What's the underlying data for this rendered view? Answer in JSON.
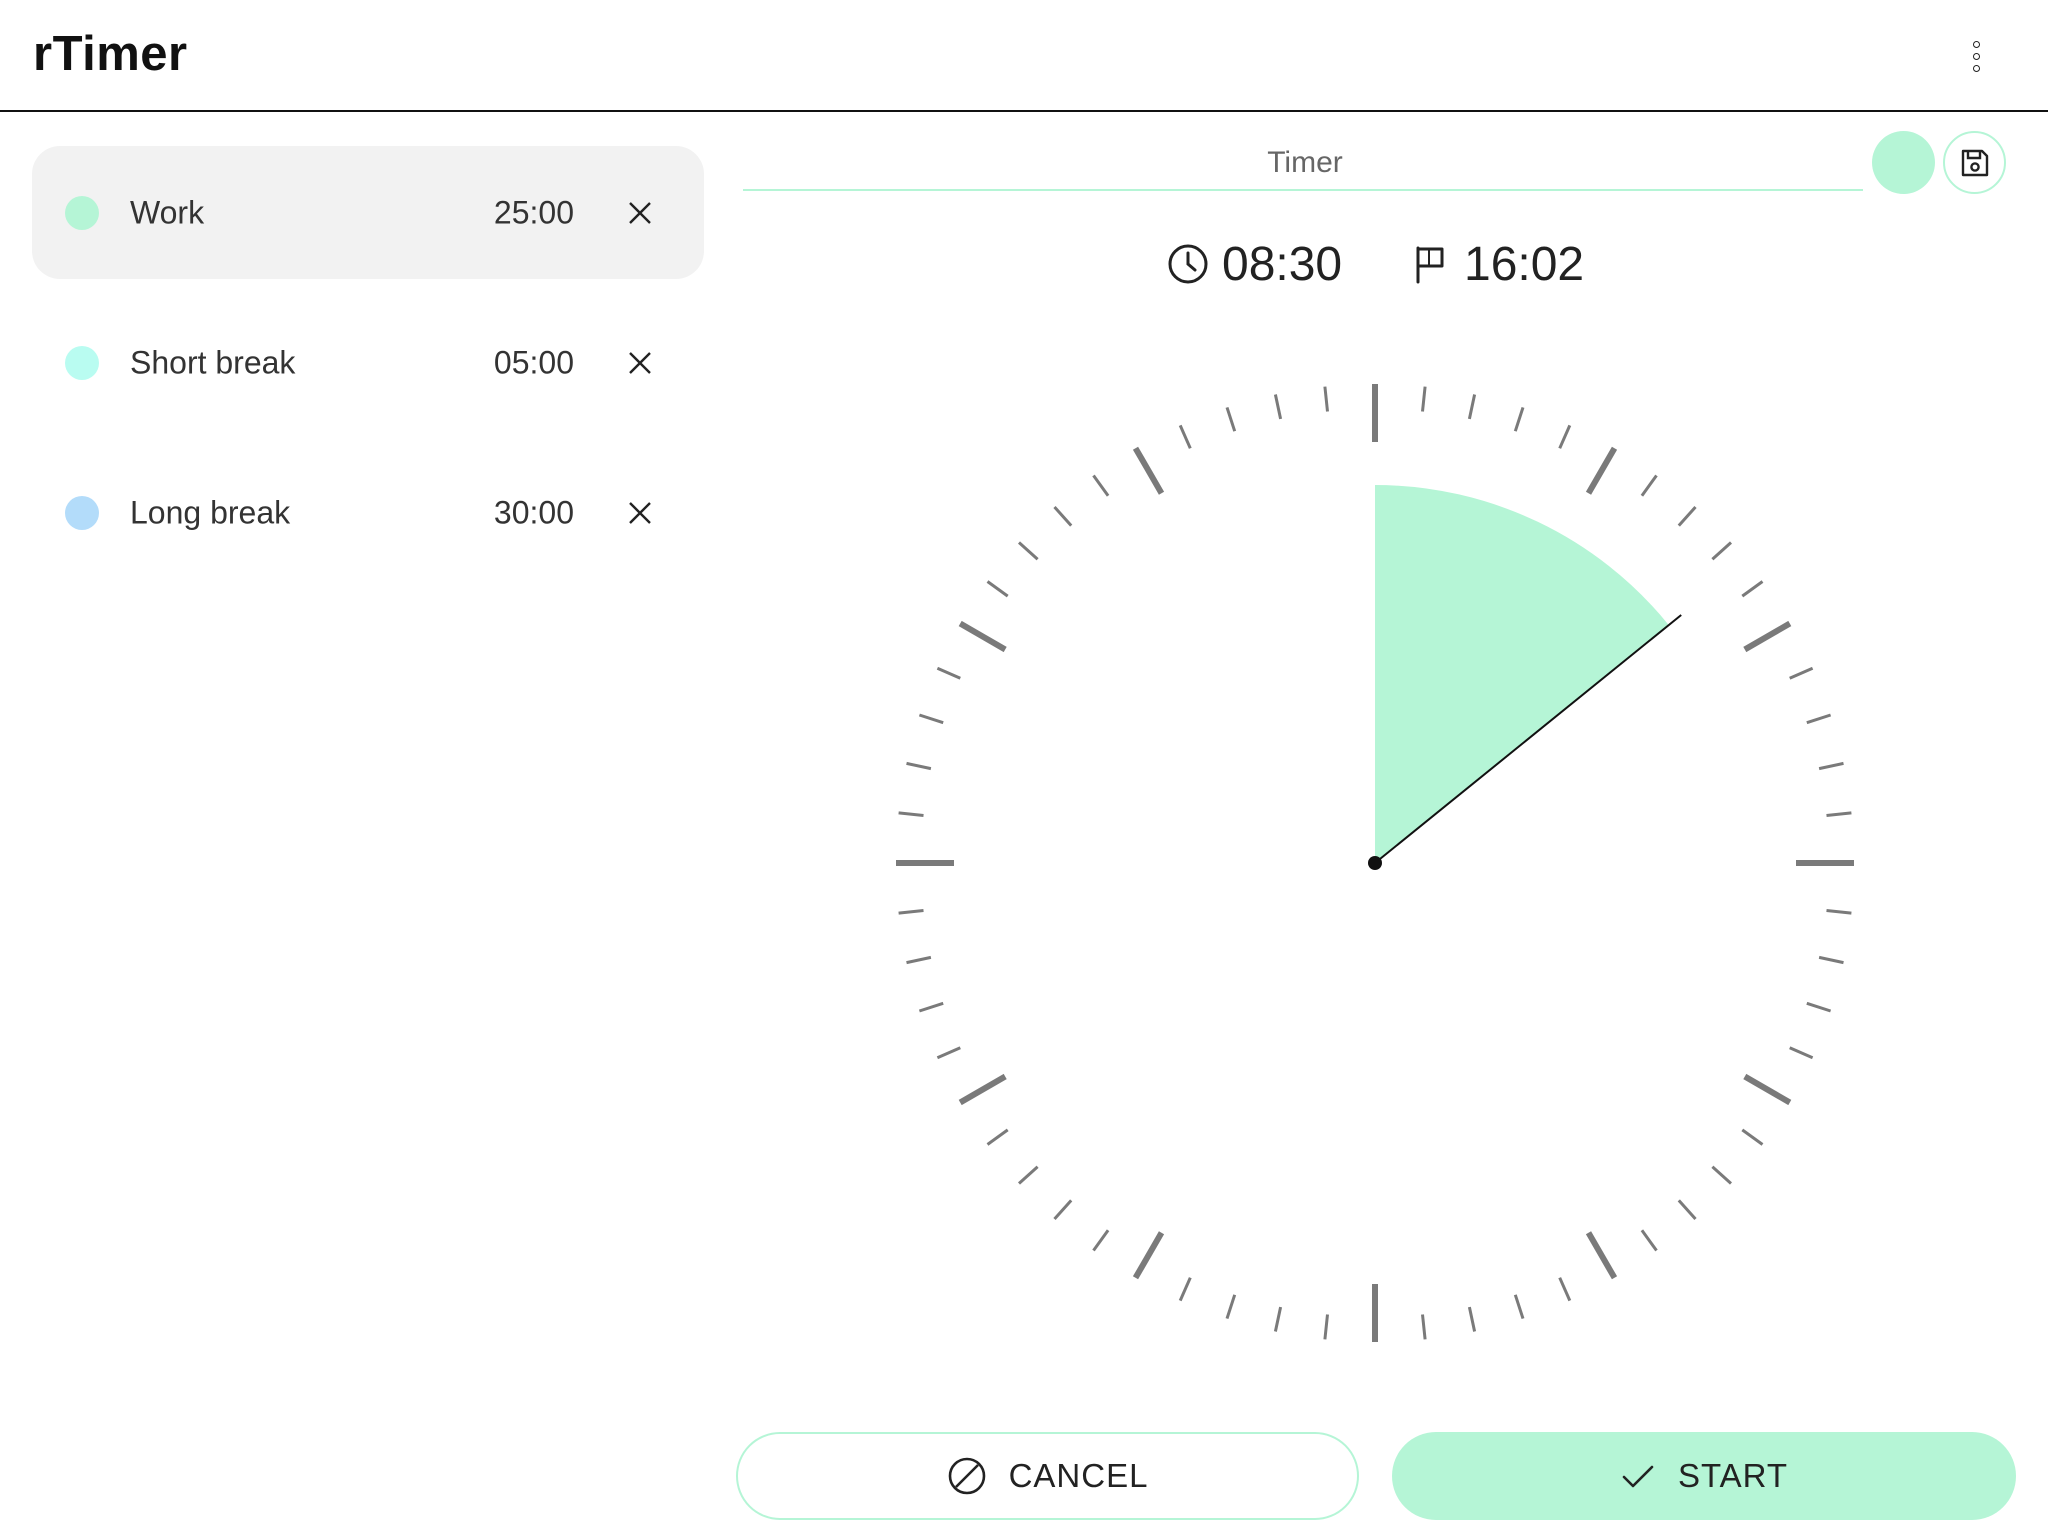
{
  "app": {
    "title": "rTimer"
  },
  "colors": {
    "accent": "#b5f5d6",
    "work": "#b5f5d6",
    "short_break": "#b9fcf1",
    "long_break": "#b3dcfa",
    "tick": "#7a7a7a"
  },
  "presets": [
    {
      "label": "Work",
      "time": "25:00",
      "color": "#b5f5d6",
      "selected": true
    },
    {
      "label": "Short break",
      "time": "05:00",
      "color": "#b9fcf1",
      "selected": false
    },
    {
      "label": "Long break",
      "time": "30:00",
      "color": "#b3dcfa",
      "selected": false
    }
  ],
  "editor": {
    "name_placeholder": "Timer",
    "name_value": "",
    "swatch_color": "#b5f5d6"
  },
  "info": {
    "duration": "08:30",
    "end_time": "16:02",
    "duration_icon": "clock-icon",
    "end_icon": "flag-icon"
  },
  "dial": {
    "minutes": 8.5,
    "max_minutes": 60,
    "ticks": 60
  },
  "actions": {
    "cancel_label": "CANCEL",
    "start_label": "START"
  },
  "icons": {
    "menu": "more-vertical-icon",
    "remove": "close-icon",
    "save": "save-icon",
    "cancel": "block-icon",
    "start": "check-icon"
  }
}
